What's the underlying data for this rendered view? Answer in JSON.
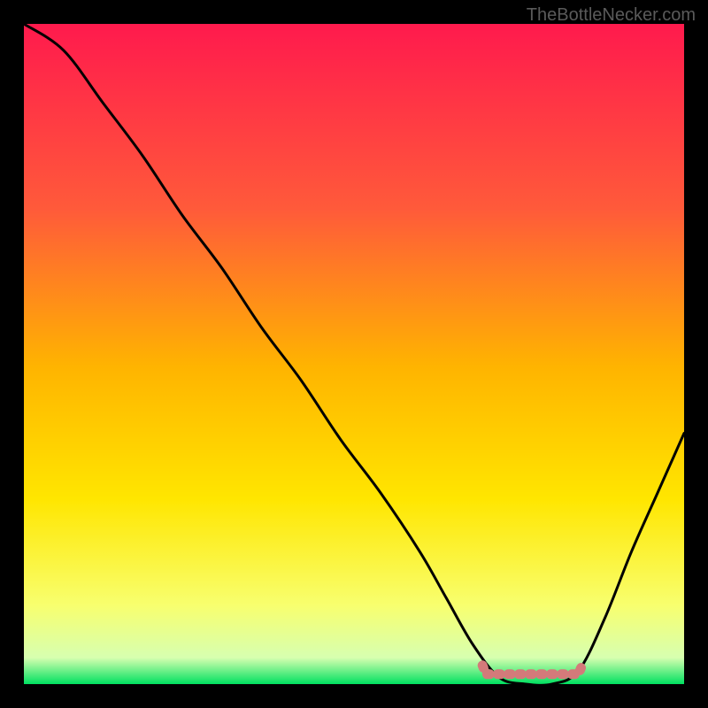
{
  "watermark": "TheBottleNecker.com",
  "chart_data": {
    "type": "line",
    "title": "",
    "xlabel": "",
    "ylabel": "",
    "xlim": [
      0,
      100
    ],
    "ylim": [
      0,
      100
    ],
    "series": [
      {
        "name": "bottleneck-curve",
        "x": [
          0,
          6,
          12,
          18,
          24,
          30,
          36,
          42,
          48,
          54,
          60,
          64,
          68,
          72,
          76,
          80,
          84,
          88,
          92,
          96,
          100
        ],
        "values": [
          100,
          96,
          88,
          80,
          71,
          63,
          54,
          46,
          37,
          29,
          20,
          13,
          6,
          1,
          0,
          0,
          2,
          10,
          20,
          29,
          38
        ]
      }
    ],
    "optimal_band": {
      "start_x": 70,
      "end_x": 84,
      "y": 1.5
    },
    "gradient_stops": [
      {
        "offset": 0.0,
        "color": "#ff1a4d"
      },
      {
        "offset": 0.28,
        "color": "#ff5a3a"
      },
      {
        "offset": 0.52,
        "color": "#ffb400"
      },
      {
        "offset": 0.72,
        "color": "#ffe600"
      },
      {
        "offset": 0.88,
        "color": "#f8ff6e"
      },
      {
        "offset": 0.96,
        "color": "#d7ffb0"
      },
      {
        "offset": 1.0,
        "color": "#00e060"
      }
    ]
  }
}
